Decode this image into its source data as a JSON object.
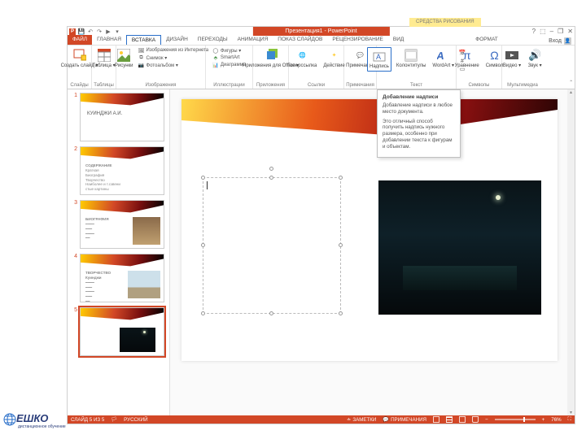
{
  "titlebar": {
    "doc_title": "Презентация1 - PowerPoint",
    "context_tools": "СРЕДСТВА РИСОВАНИЯ",
    "help": "?",
    "ribbon_opts": "⬚",
    "min": "–",
    "restore": "❐",
    "close": "✕"
  },
  "tabs": {
    "file": "ФАЙЛ",
    "home": "ГЛАВНАЯ",
    "insert": "ВСТАВКА",
    "design": "ДИЗАЙН",
    "transitions": "ПЕРЕХОДЫ",
    "animations": "АНИМАЦИЯ",
    "slideshow": "ПОКАЗ СЛАЙДОВ",
    "review": "РЕЦЕНЗИРОВАНИЕ",
    "view": "ВИД",
    "format": "ФОРМАТ",
    "signin": "Вход"
  },
  "ribbon": {
    "slides": {
      "new_slide": "Создать\nслайд ▾",
      "table": "Таблица\n▾",
      "group": "Слайды",
      "group2": "Таблицы"
    },
    "images": {
      "pictures": "Рисунки",
      "online": "Изображения из Интернета",
      "screenshot": "Снимок ▾",
      "album": "Фотоальбом ▾",
      "group": "Изображения"
    },
    "illus": {
      "shapes": "Фигуры ▾",
      "smartart": "SmartArt",
      "chart": "Диаграмма",
      "group": "Иллюстрации"
    },
    "apps": {
      "apps": "Приложения\nдля Office ▾",
      "group": "Приложения"
    },
    "links": {
      "hyperlink": "Гиперссылка",
      "action": "Действие",
      "group": "Ссылки"
    },
    "comments": {
      "comment": "Примечание",
      "group": "Примечания"
    },
    "text": {
      "textbox": "Надпись",
      "headerfooter": "Колонтитулы",
      "wordart": "WordArt\n▾",
      "group": "Текст"
    },
    "symbols": {
      "equation": "Уравнение",
      "symbol": "Символ",
      "group": "Символы"
    },
    "media": {
      "video": "Видео\n▾",
      "audio": "Звук\n▾",
      "group": "Мультимедиа"
    }
  },
  "tooltip": {
    "title": "Добавление надписи",
    "p1": "Добавление надписи в любое место документа.",
    "p2": "Это отличный способ получить надпись нужного размера, особенно при добавлении текста к фигурам и объектам."
  },
  "thumbs": {
    "t1": "КУИНДЖИ А.И.",
    "t2": "СОДЕРЖАНИЕ",
    "t3": "БИОГРАФИЯ",
    "t4": "ТВОРЧЕСТВО Куинджи"
  },
  "statusbar": {
    "slide": "СЛАЙД 5 ИЗ 5",
    "lang": "РУССКИЙ",
    "notes": "ЗАМЕТКИ",
    "comments": "ПРИМЕЧАНИЯ",
    "zoom": "76%"
  },
  "logo": {
    "brand": "ЕШКО",
    "sub": "дистанционное\nобучение"
  }
}
